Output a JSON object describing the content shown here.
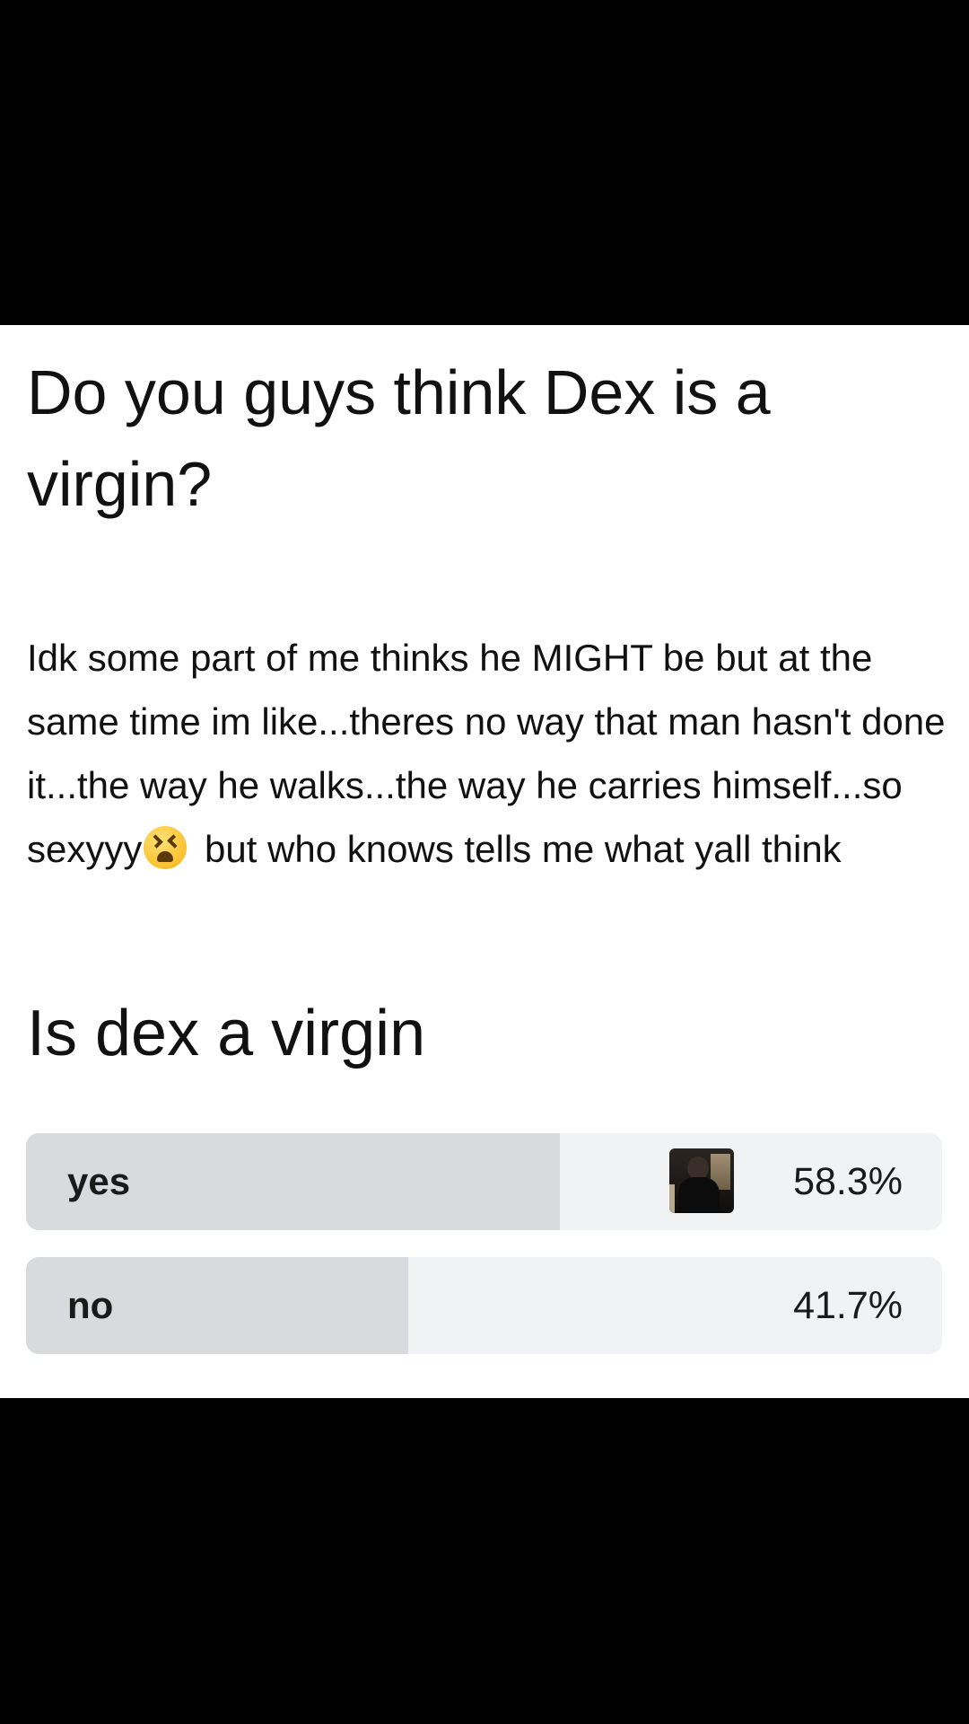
{
  "post": {
    "title": "Do you guys think Dex is a virgin?",
    "body_part1": "Idk some part of me thinks he MIGHT be but at the same time im like...theres no way that man hasn't done it...the way he walks...the way he carries himself...so sexyyy",
    "body_emoji": "tired-face-emoji",
    "body_part2": " but who knows tells me what yall think"
  },
  "poll": {
    "question": "Is dex a virgin",
    "options": [
      {
        "label": "yes",
        "percent_text": "58.3%",
        "percent": 58.3,
        "has_voter_avatar": true
      },
      {
        "label": "no",
        "percent_text": "41.7%",
        "percent": 41.7,
        "has_voter_avatar": false
      }
    ]
  },
  "colors": {
    "background_band": "#000000",
    "card": "#ffffff",
    "text": "#111111",
    "poll_track": "#f1f2f4",
    "poll_fill": "#d8dadd"
  }
}
